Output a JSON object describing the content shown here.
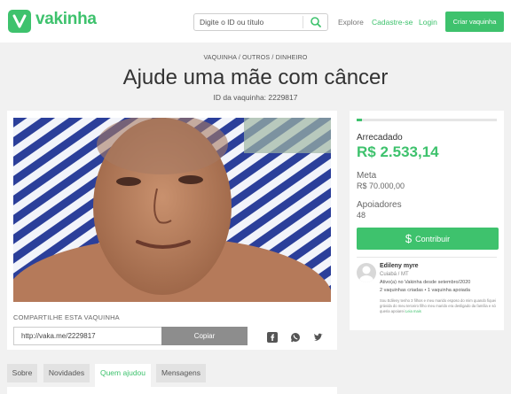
{
  "header": {
    "logo_text": "vakinha",
    "search_placeholder": "Digite o ID ou título",
    "nav": {
      "explore": "Explore",
      "signup": "Cadastre-se",
      "login": "Login"
    },
    "create_button": "Criar vaquinha",
    "brand_color": "#3ec26d"
  },
  "campaign": {
    "breadcrumb": "VAQUINHA / OUTROS / DINHEIRO",
    "title": "Ajude uma mãe com câncer",
    "id_text": "ID da vaquinha: 2229817"
  },
  "share": {
    "title": "COMPARTILHE ESTA VAQUINHA",
    "link": "http://vaka.me/2229817",
    "copy_label": "Copiar",
    "icons": [
      "facebook-icon",
      "whatsapp-icon",
      "twitter-icon"
    ]
  },
  "stats": {
    "progress_fraction": 0.036,
    "raised_label": "Arrecadado",
    "raised_value": "R$ 2.533,14",
    "meta_label": "Meta",
    "meta_value": "R$ 70.000,00",
    "supporters_label": "Apoiadores",
    "supporters_value": "48",
    "contribute_label": "Contribuir"
  },
  "owner": {
    "name": "Edileny myre",
    "location": "Cuiabá / MT",
    "active_text": "Ativo(a) no Vakinha desde setembro/2020",
    "stats_text": "2 vaquinhas criadas  •  1 vaquinha apoiada",
    "bio": "Sou Edileny tenho 3 filhos e meu marido esposo do mim quando fiquei grávida do meu terceiro filho meu marido era desligado da família e só queria apoiarei",
    "more_label": "Leia mais"
  },
  "tabs": [
    {
      "label": "Sobre",
      "active": false
    },
    {
      "label": "Novidades",
      "active": false
    },
    {
      "label": "Quem ajudou",
      "active": true
    },
    {
      "label": "Mensagens",
      "active": false
    }
  ]
}
